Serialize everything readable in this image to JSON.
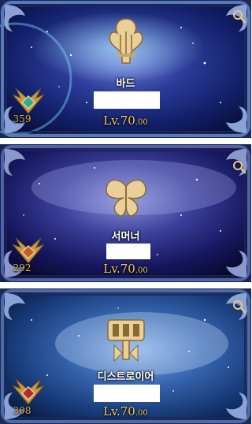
{
  "cards": [
    {
      "class_name": "바드",
      "class_icon": "harp-icon",
      "item_level": "359",
      "level_prefix": "Lv.",
      "level_value": "70",
      "level_decimal": ".00",
      "gem_color": "#2fb08a"
    },
    {
      "class_name": "서머너",
      "class_icon": "butterfly-icon",
      "item_level": "292",
      "level_prefix": "Lv.",
      "level_value": "70",
      "level_decimal": ".00",
      "gem_color": "#c85a2a"
    },
    {
      "class_name": "디스트로이어",
      "class_icon": "hammer-icon",
      "item_level": "308",
      "level_prefix": "Lv.",
      "level_value": "70",
      "level_decimal": ".00",
      "gem_color": "#b52a2a"
    }
  ],
  "icons": {
    "zoom": "magnifier-icon",
    "rank_badge": "wing-badge-icon"
  },
  "colors": {
    "level_gold": "#f2c85b",
    "frame_blue": "#3b5a9a",
    "sky_dark": "#0a1640"
  }
}
